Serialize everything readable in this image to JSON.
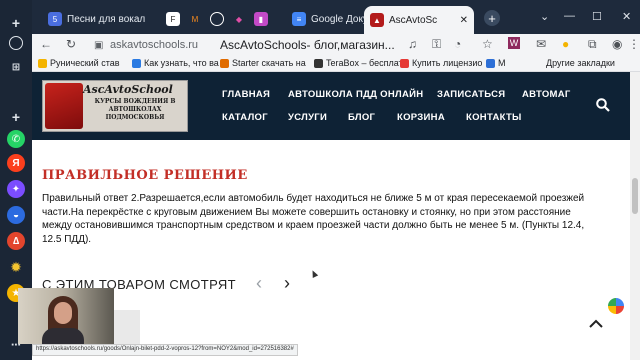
{
  "browser": {
    "tabs": [
      {
        "label": "5",
        "title": "Песни для вокал",
        "fav_color": "#4a6ee0"
      },
      {
        "label": "",
        "title": "",
        "fav_color": "#ffffff"
      },
      {
        "label": "",
        "title": "",
        "fav_color": "#e0e0e0"
      },
      {
        "label": "",
        "title": "Google Докум",
        "fav_color": "#4285f4"
      },
      {
        "label": "",
        "title": "AscAvtoSc",
        "fav_color": "#b31b1b"
      }
    ],
    "url_host": "askavtoschools.ru",
    "url_title": "AscAvtoSchools- блог,магазин...",
    "bookmarks": [
      "Рунический став",
      "Как узнать, что ва",
      "Starter скачать на",
      "TeraBox – бесплат",
      "Купить лицензио",
      "M"
    ],
    "other_bookmarks": "Другие закладки"
  },
  "site": {
    "logo_brand": "AscAvtoSchool",
    "logo_sub": "КУРСЫ ВОЖДЕНИЯ В АВТОШКОЛАХ ПОДМОСКОВЬЯ",
    "nav": [
      "ГЛАВНАЯ",
      "АВТОШКОЛА ПДД ОНЛАЙН",
      "ЗАПИСАТЬСЯ",
      "АВТОМАГ",
      "КАТАЛОГ",
      "УСЛУГИ",
      "БЛОГ",
      "КОРЗИНА",
      "КОНТАКТЫ"
    ]
  },
  "content": {
    "answer_heading": "ПРАВИЛЬНОЕ РЕШЕНИЕ",
    "answer_text": "Правильный ответ 2.Разрешается,если автомобиль будет находиться не ближе 5 м от края пересекаемой проезжей части.На перекрёстке с круговым движением Вы можете совершить остановку и стоянку, но при этом расстояние между остановившимся транспортным средством и краем проезжей части должно быть не менее 5 м. (Пункты 12.4, 12.5 ПДД).",
    "related_heading": "С ЭТИМ ТОВАРОМ СМОТРЯТ"
  },
  "status_url": "https://askavtoschools.ru/goods/Onlajn-bilet-pdd-2-vopros-12?from=NOY2&mod_id=272516382#",
  "colors": {
    "nav_bg": "#0e2235",
    "heading_red": "#c32f27",
    "tab_bg": "#1e2a3c"
  }
}
